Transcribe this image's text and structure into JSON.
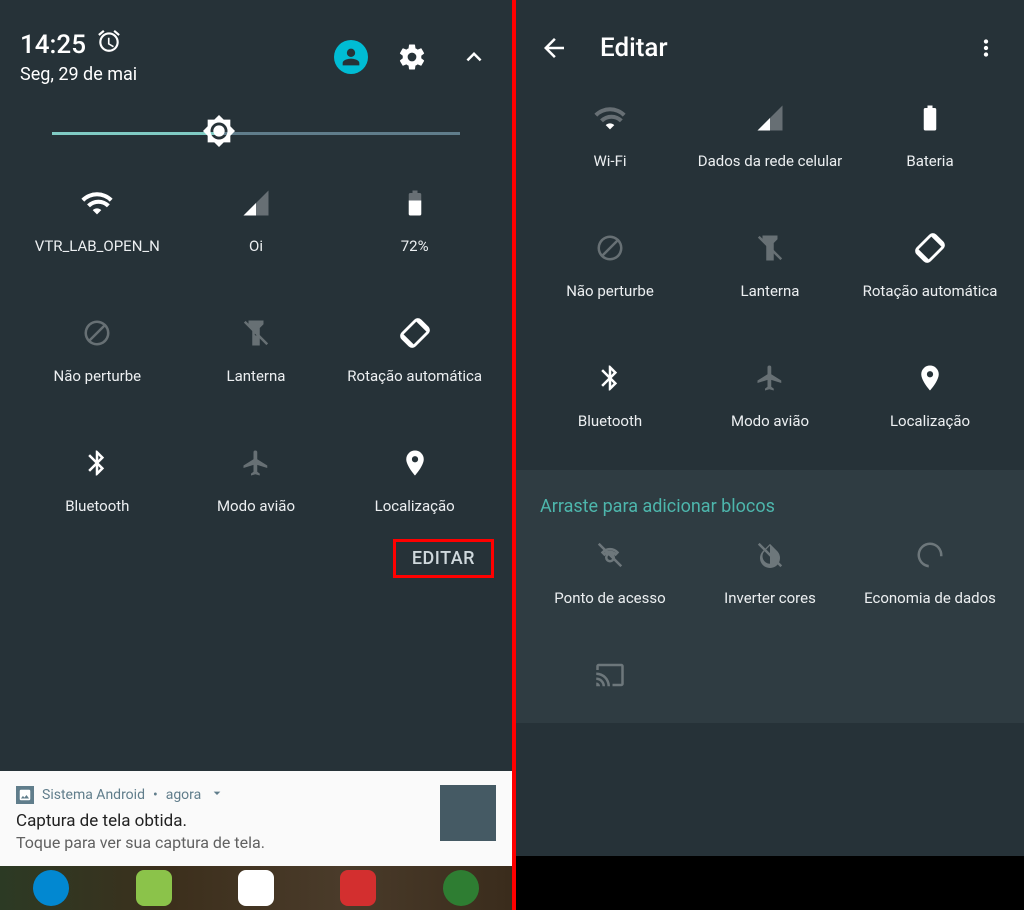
{
  "left": {
    "time": "14:25",
    "date": "Seg, 29 de mai",
    "tiles": [
      {
        "label": "VTR_LAB_OPEN_N"
      },
      {
        "label": "Oi"
      },
      {
        "label": "72%"
      },
      {
        "label": "Não perturbe"
      },
      {
        "label": "Lanterna"
      },
      {
        "label": "Rotação automática"
      },
      {
        "label": "Bluetooth"
      },
      {
        "label": "Modo avião"
      },
      {
        "label": "Localização"
      }
    ],
    "edit_label": "EDITAR",
    "notification": {
      "app": "Sistema Android",
      "sep": "•",
      "when": "agora",
      "title": "Captura de tela obtida.",
      "subtitle": "Toque para ver sua captura de tela."
    }
  },
  "right": {
    "title": "Editar",
    "tiles": [
      {
        "label": "Wi-Fi"
      },
      {
        "label": "Dados da rede celular"
      },
      {
        "label": "Bateria"
      },
      {
        "label": "Não perturbe"
      },
      {
        "label": "Lanterna"
      },
      {
        "label": "Rotação automática"
      },
      {
        "label": "Bluetooth"
      },
      {
        "label": "Modo avião"
      },
      {
        "label": "Localização"
      }
    ],
    "drag_title": "Arraste para adicionar blocos",
    "drag_tiles": [
      {
        "label": "Ponto de acesso"
      },
      {
        "label": "Inverter cores"
      },
      {
        "label": "Economia de dados"
      }
    ]
  },
  "colors": {
    "accent": "#00bcd4",
    "teal": "#4db6ac",
    "highlight": "#f00"
  }
}
